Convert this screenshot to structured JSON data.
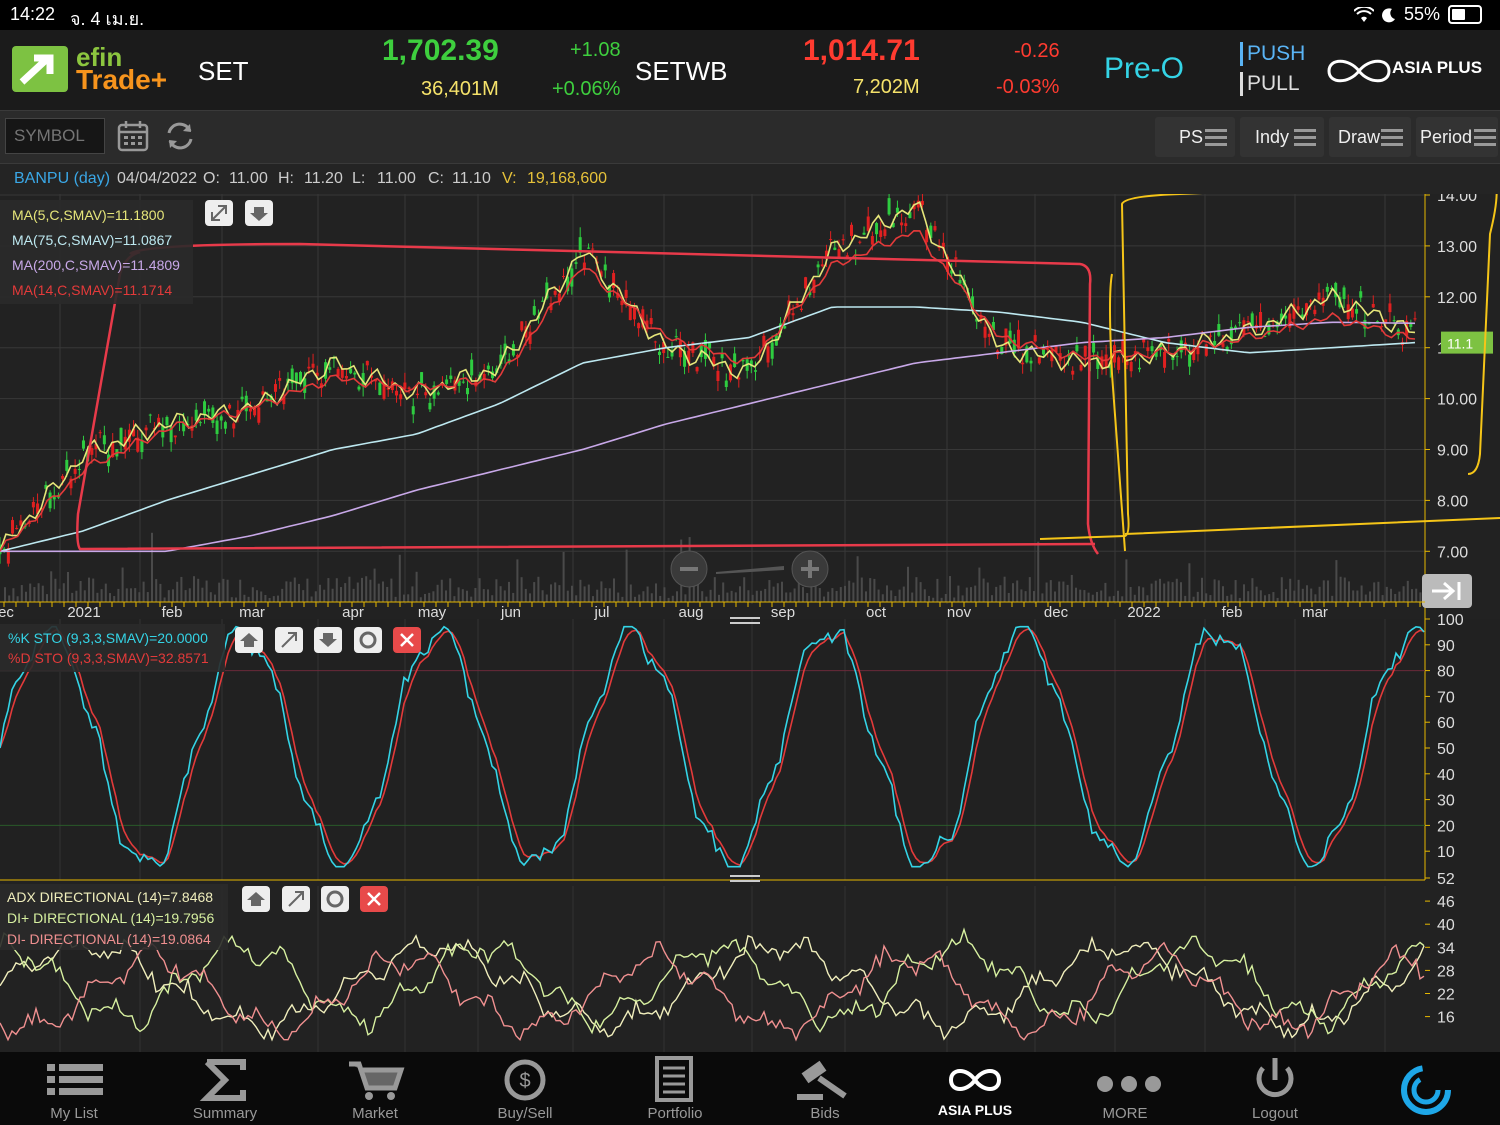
{
  "status": {
    "time": "14:22",
    "date": "จ. 4 เม.ย.",
    "battery": "55%",
    "battery_level": 0.55
  },
  "header": {
    "logo_top": "efin",
    "logo_bottom": "Trade+",
    "idx1": {
      "name": "SET",
      "value": "1,702.39",
      "change": "+1.08",
      "volume": "36,401M",
      "pct": "+0.06%"
    },
    "idx2": {
      "name": "SETWB",
      "value": "1,014.71",
      "change": "-0.26",
      "volume": "7,202M",
      "pct": "-0.03%"
    },
    "session": "Pre-O",
    "push": "PUSH",
    "pull": "PULL",
    "broker": "ASIA PLUS"
  },
  "toolbar": {
    "symbol_placeholder": "SYMBOL",
    "ps": "PS",
    "indy": "Indy",
    "draw": "Draw",
    "period": "Period"
  },
  "info": {
    "symbol": "BANPU (day)",
    "date": "04/04/2022",
    "o_label": "O:",
    "o": "11.00",
    "h_label": "H:",
    "h": "11.20",
    "l_label": "L:",
    "l": "11.00",
    "c_label": "C:",
    "c": "11.10",
    "v_label": "V:",
    "v": "19,168,600"
  },
  "legend_main": [
    {
      "text": "MA(5,C,SMAV)=11.1800",
      "color": "#e6e67a"
    },
    {
      "text": "MA(75,C,SMAV)=11.0867",
      "color": "#bde8f0"
    },
    {
      "text": "MA(200,C,SMAV)=11.4809",
      "color": "#c8a8e8"
    },
    {
      "text": "MA(14,C,SMAV)=11.1714",
      "color": "#e33a3a"
    }
  ],
  "legend_sto": [
    {
      "text": "%K STO (9,3,3,SMAV)=20.0000",
      "color": "#34d4e6"
    },
    {
      "text": "%D STO (9,3,3,SMAV)=32.8571",
      "color": "#e33a3a"
    }
  ],
  "legend_adx": [
    {
      "text": "ADX DIRECTIONAL (14)=7.8468",
      "color": "#f0eebc"
    },
    {
      "text": "DI+ DIRECTIONAL (14)=19.7956",
      "color": "#d7f0a0"
    },
    {
      "text": "DI- DIRECTIONAL (14)=19.0864",
      "color": "#f09090"
    }
  ],
  "price_axis": [
    "14.00",
    "13.00",
    "12.00",
    "11.00",
    "10.00",
    "9.00",
    "8.00",
    "7.00"
  ],
  "price_tag": "11.1",
  "sto_axis": [
    "100",
    "90",
    "80",
    "70",
    "60",
    "50",
    "40",
    "30",
    "20",
    "10"
  ],
  "adx_axis": [
    "52",
    "46",
    "40",
    "34",
    "28",
    "22",
    "16"
  ],
  "months": [
    "ec",
    "2021",
    "feb",
    "mar",
    "apr",
    "may",
    "jun",
    "jul",
    "aug",
    "sep",
    "oct",
    "nov",
    "dec",
    "2022",
    "feb",
    "mar"
  ],
  "nav": [
    "My List",
    "Summary",
    "Market",
    "Buy/Sell",
    "Portfolio",
    "Bids",
    "ASIA PLUS",
    "MORE",
    "Logout"
  ],
  "colors": {
    "up": "#3ecf3e",
    "down": "#ff3b30",
    "accent": "#34d4e6",
    "price_candle_up": "#2ecc40",
    "price_candle_down": "#e02020"
  },
  "chart_data": {
    "type": "line",
    "series": [
      {
        "name": "MA(5,C,SMAV)",
        "values": [
          7.0,
          8.9,
          9.5,
          9.8,
          10.7,
          10.1,
          10.6,
          12.9,
          11.0,
          10.5,
          12.9,
          13.8,
          11.0,
          10.7,
          10.9,
          11.3,
          12.0,
          11.3
        ]
      },
      {
        "name": "MA(75,C,SMAV)",
        "values": [
          7.0,
          7.4,
          8.0,
          8.5,
          9.0,
          9.3,
          9.9,
          10.7,
          11.0,
          11.2,
          11.8,
          11.8,
          11.7,
          11.5,
          11.1,
          10.9,
          11.0,
          11.1
        ]
      },
      {
        "name": "MA(200,C,SMAV)",
        "values": [
          7.0,
          7.0,
          7.0,
          7.3,
          7.7,
          8.2,
          8.6,
          9.0,
          9.5,
          9.9,
          10.3,
          10.7,
          10.9,
          11.1,
          11.2,
          11.4,
          11.5,
          11.48
        ]
      },
      {
        "name": "MA(14,C,SMAV)",
        "values": [
          7.0,
          8.6,
          9.4,
          9.8,
          10.4,
          10.2,
          10.4,
          12.6,
          11.2,
          10.7,
          12.6,
          13.3,
          11.2,
          10.8,
          10.9,
          11.2,
          11.6,
          11.17
        ]
      }
    ],
    "x": [
      "dec",
      "2021",
      "feb",
      "mar",
      "apr",
      "may",
      "jun",
      "jul",
      "aug",
      "sep",
      "oct",
      "nov",
      "dec",
      "2022",
      "feb",
      "mar",
      "mar",
      "apr"
    ],
    "ylim": [
      7,
      14
    ]
  }
}
